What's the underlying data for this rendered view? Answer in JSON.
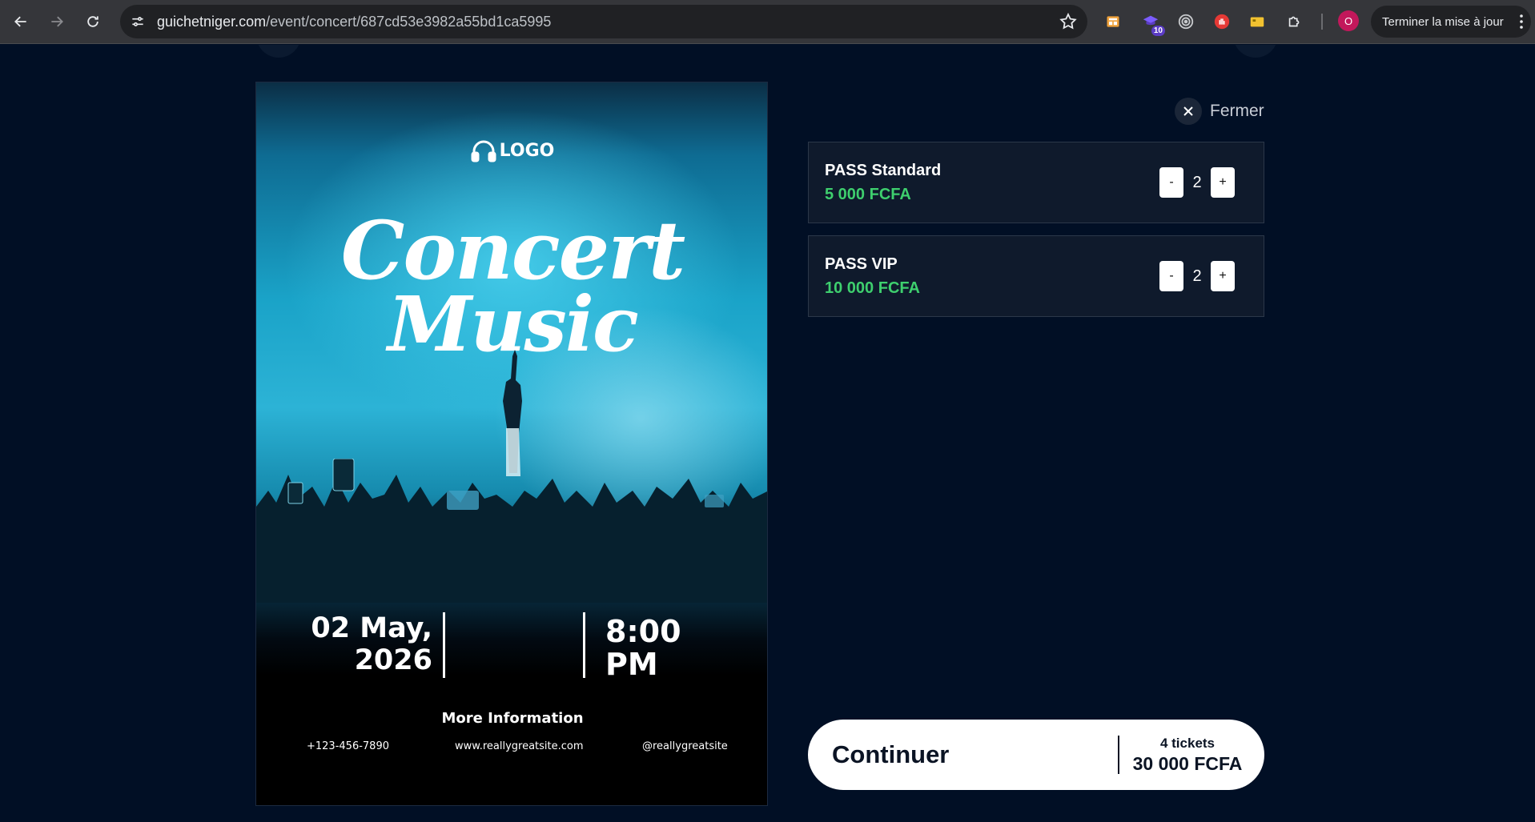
{
  "browser": {
    "url_host": "guichetniger.com",
    "url_path": "/event/concert/687cd53e3982a55bd1ca5995",
    "extension_badge": "10",
    "profile_initial": "O",
    "update_label": "Terminer la mise à jour"
  },
  "poster": {
    "logo": "LOGO",
    "title_line1": "Concert",
    "title_line2": "Music",
    "date_line1": "02 May,",
    "date_line2": "2026",
    "time_line1": "8:00",
    "time_line2": "PM",
    "more_info": "More Information",
    "phone": "+123-456-7890",
    "website": "www.reallygreatsite.com",
    "social": "@reallygreatsite"
  },
  "panel": {
    "close_label": "Fermer",
    "tickets": [
      {
        "name": "PASS Standard",
        "price": "5 000 FCFA",
        "minus": "-",
        "quantity": "2",
        "plus": "+"
      },
      {
        "name": "PASS VIP",
        "price": "10 000 FCFA",
        "minus": "-",
        "quantity": "2",
        "plus": "+"
      }
    ],
    "continue_label": "Continuer",
    "ticket_count": "4 tickets",
    "total": "30 000 FCFA"
  },
  "colors": {
    "background": "#010f25",
    "price_green": "#3ecf6e",
    "card_bg": "#0f1a2c"
  }
}
